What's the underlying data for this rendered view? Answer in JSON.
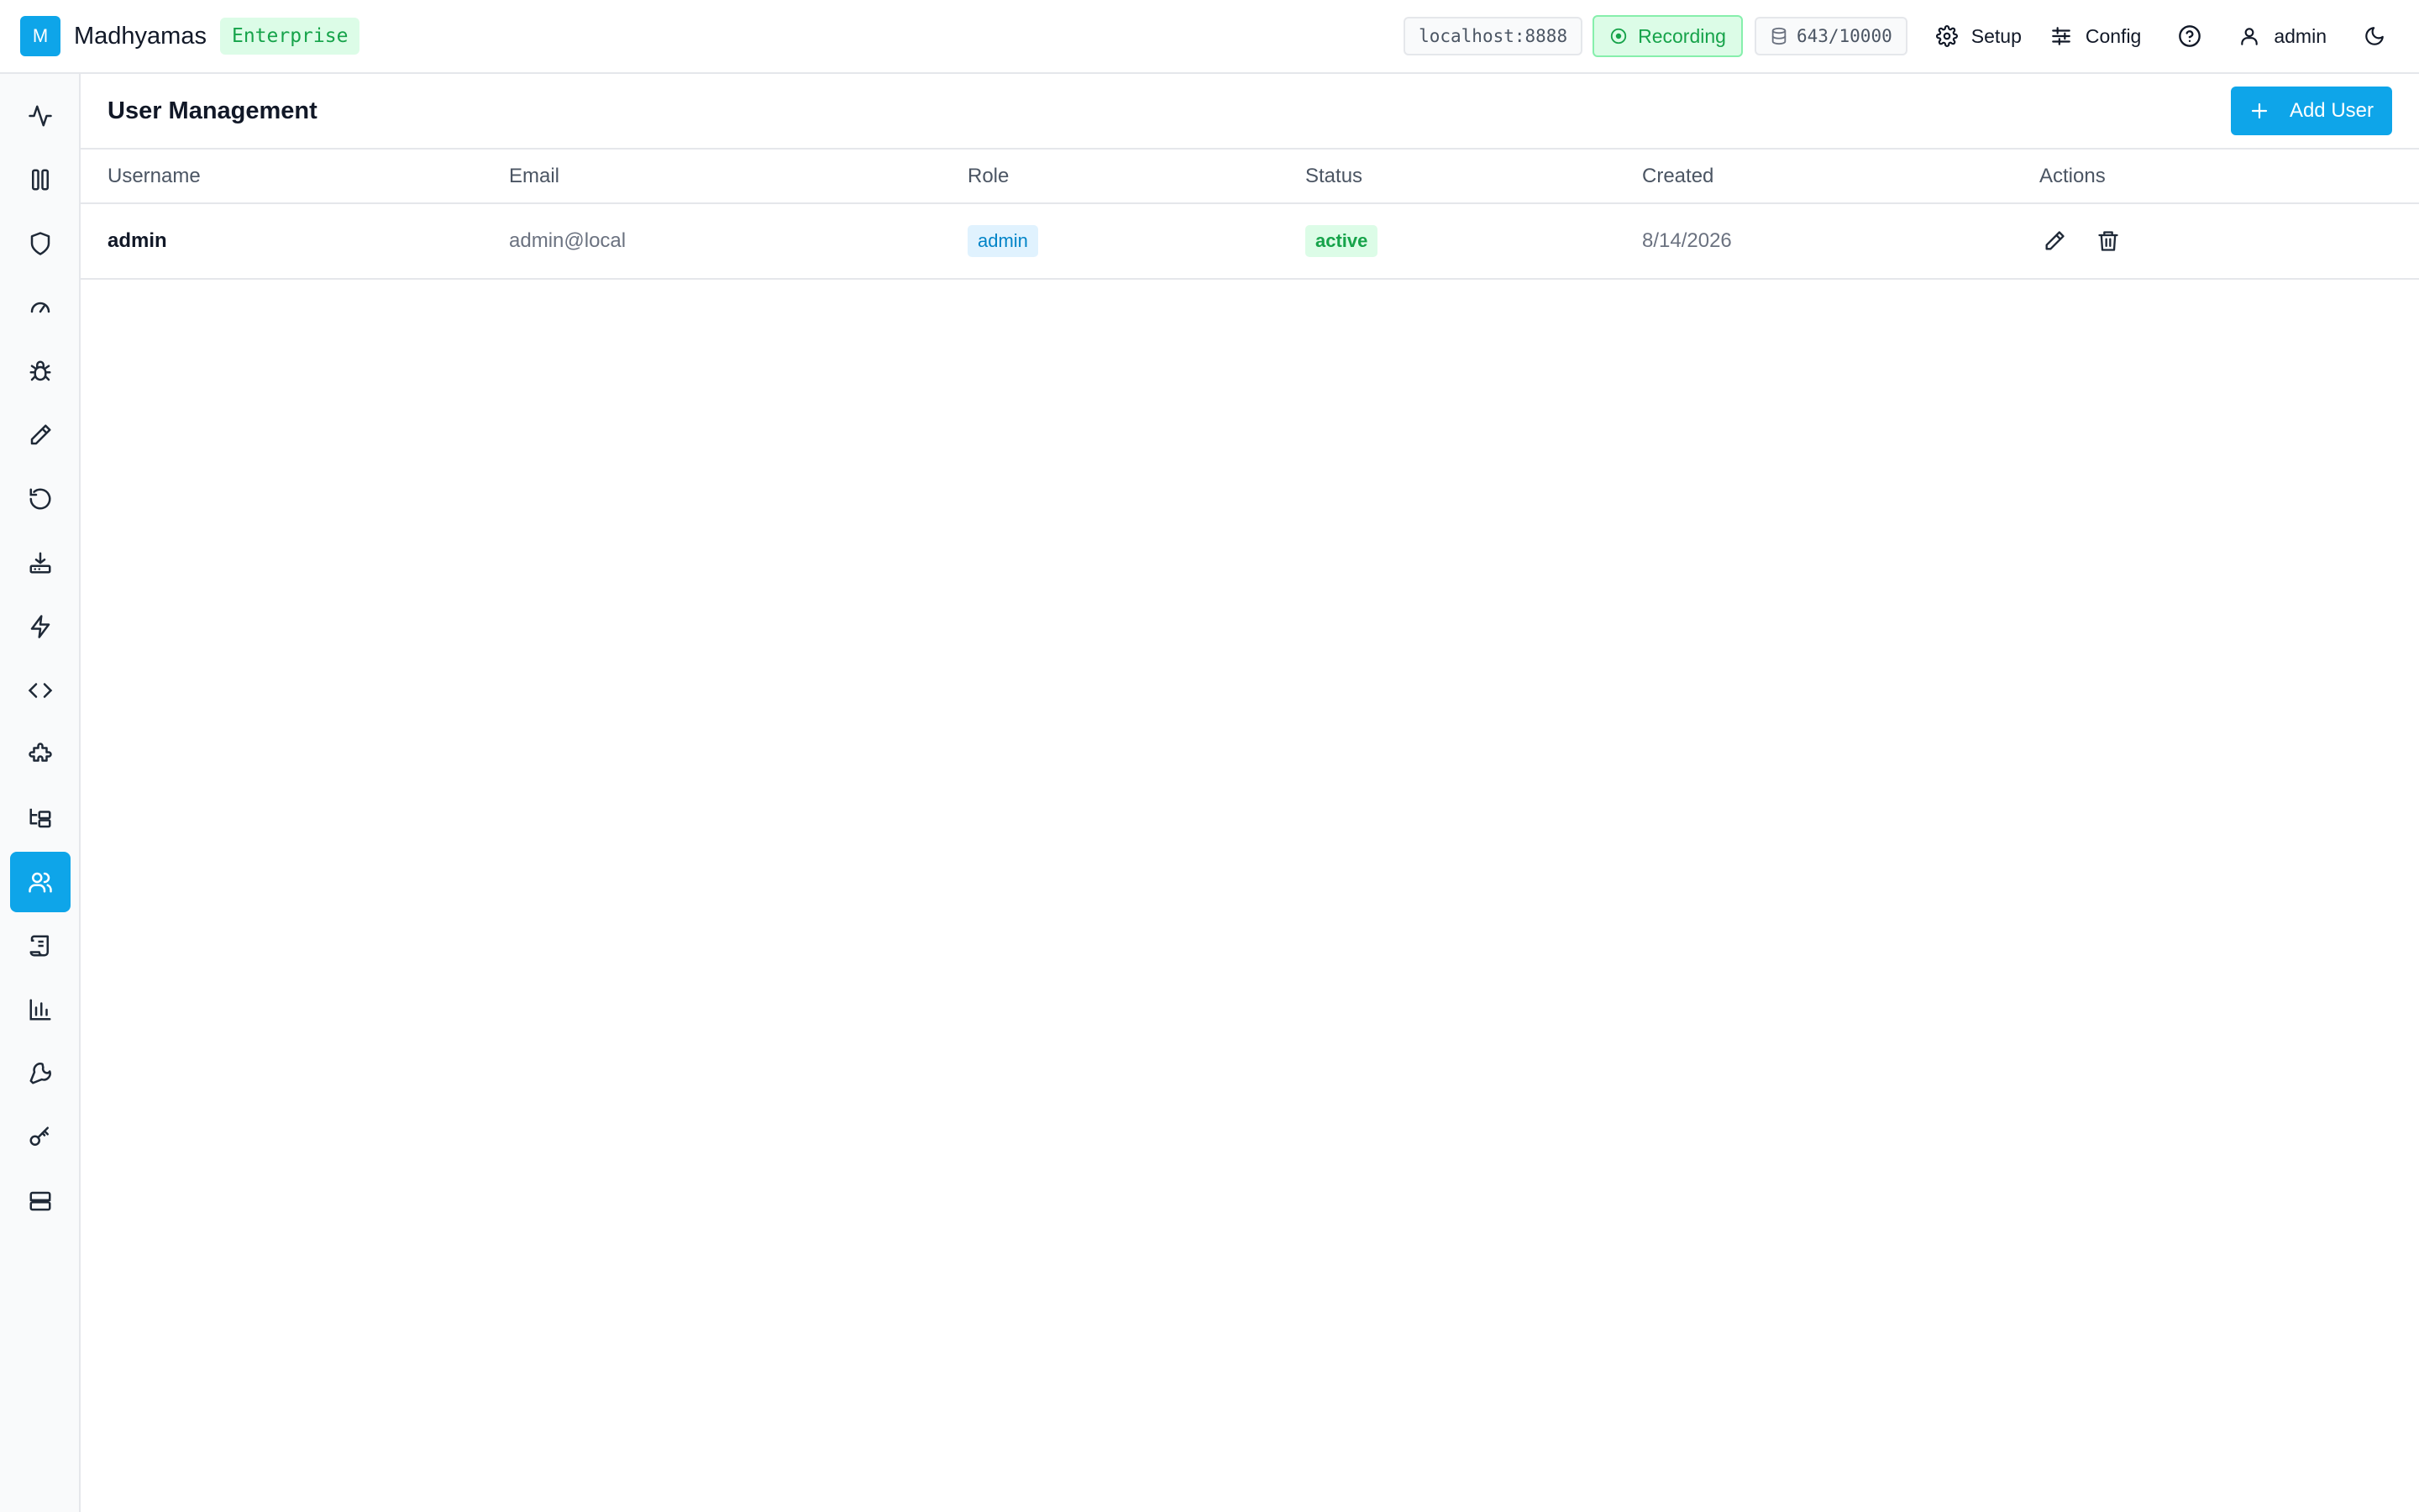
{
  "header": {
    "logo_letter": "M",
    "app_name": "Madhyamas",
    "edition": "Enterprise",
    "host": "localhost:8888",
    "recording_label": "Recording",
    "storage_count": "643/10000",
    "setup_label": "Setup",
    "config_label": "Config",
    "user_label": "admin"
  },
  "sidebar": {
    "items": [
      {
        "icon": "activity-icon"
      },
      {
        "icon": "columns-icon"
      },
      {
        "icon": "shield-icon"
      },
      {
        "icon": "gauge-icon"
      },
      {
        "icon": "bug-icon"
      },
      {
        "icon": "pencil-icon"
      },
      {
        "icon": "replay-icon"
      },
      {
        "icon": "download-icon"
      },
      {
        "icon": "zap-icon"
      },
      {
        "icon": "code-icon"
      },
      {
        "icon": "puzzle-icon"
      },
      {
        "icon": "folder-tree-icon"
      },
      {
        "icon": "users-icon",
        "active": true
      },
      {
        "icon": "scroll-icon"
      },
      {
        "icon": "bar-chart-icon"
      },
      {
        "icon": "wrench-icon"
      },
      {
        "icon": "key-icon"
      },
      {
        "icon": "server-icon"
      }
    ]
  },
  "page": {
    "title": "User Management",
    "add_button": "Add User"
  },
  "table": {
    "columns": [
      "Username",
      "Email",
      "Role",
      "Status",
      "Created",
      "Actions"
    ],
    "rows": [
      {
        "username": "admin",
        "email": "admin@local",
        "role": "admin",
        "status": "active",
        "created": "8/14/2026"
      }
    ]
  },
  "colors": {
    "accent": "#0ea5e9",
    "success": "#16a34a",
    "success_bg": "#dcfce7",
    "role_bg": "#e0f2fe"
  }
}
